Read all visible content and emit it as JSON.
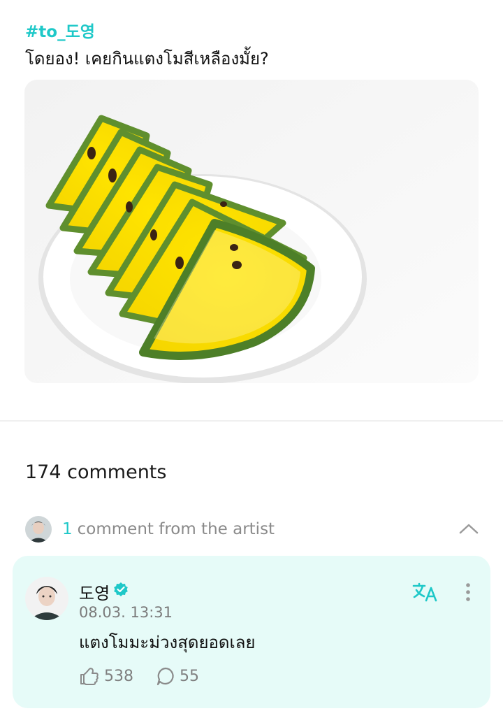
{
  "post": {
    "hashtag": "#to_도영",
    "text": "โดยอง! เคยกินแตงโมสีเหลืองมั้ย?"
  },
  "comments_section": {
    "count_label": "174 comments",
    "artist_count": "1",
    "artist_label": "comment from the artist"
  },
  "artist_comment": {
    "author": "도영",
    "timestamp": "08.03. 13:31",
    "text": "แตงโมมะม่วงสุดยอดเลย",
    "likes": "538",
    "replies": "55"
  },
  "colors": {
    "accent": "#1ec8c8",
    "card_background": "#e6fbf8",
    "muted_text": "#8a8a8a"
  },
  "icons": [
    "verified-icon",
    "translate-icon",
    "more-vertical-icon",
    "like-icon",
    "reply-icon",
    "chevron-up-icon"
  ]
}
